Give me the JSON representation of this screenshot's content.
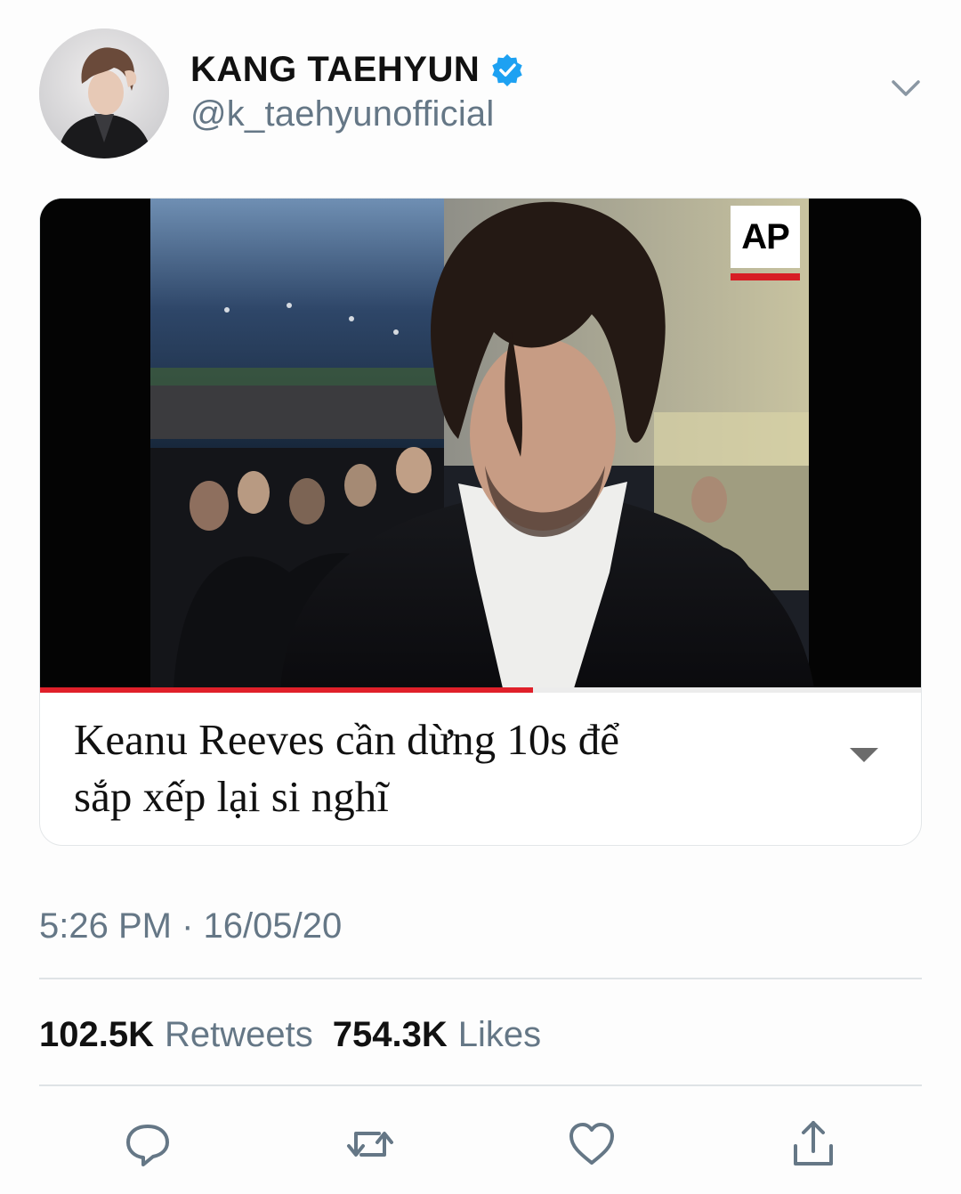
{
  "tweet": {
    "display_name": "KANG TAEHYUN",
    "handle": "@k_taehyunofficial",
    "verified": true,
    "caption_line1": "Keanu Reeves cần dừng 10s để",
    "caption_line2": "sắp xếp lại si nghĩ",
    "timestamp": "5:26 PM · 16/05/20"
  },
  "media": {
    "watermark": "AP",
    "progress_fraction": 0.56
  },
  "stats": {
    "retweets_count": "102.5K",
    "retweets_label": "Retweets",
    "likes_count": "754.3K",
    "likes_label": "Likes"
  },
  "icons": {
    "verified": "verified-badge-icon",
    "menu": "chevron-down-icon",
    "caption_menu": "caret-down-icon",
    "reply": "reply-icon",
    "retweet": "retweet-icon",
    "like": "heart-icon",
    "share": "share-icon"
  },
  "colors": {
    "verified_blue": "#1da1f2",
    "secondary_text": "#657786",
    "progress_red": "#e0202a",
    "icon_gray": "#657786"
  }
}
